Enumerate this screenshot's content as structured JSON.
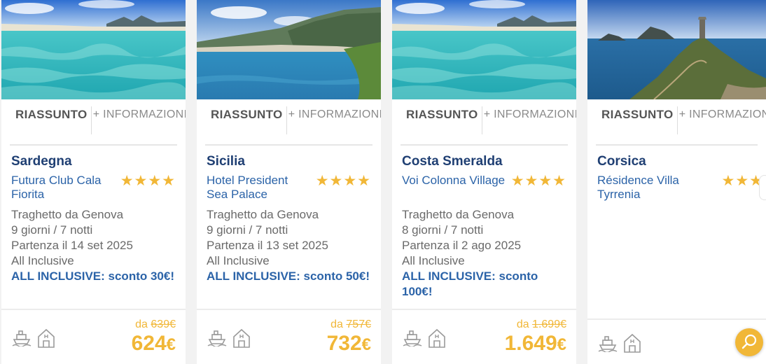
{
  "tabs": {
    "summary": "RIASSUNTO",
    "info": "+ INFORMAZIONI"
  },
  "cards": [
    {
      "region": "Sardegna",
      "hotel": "Futura Club Cala Fiorita",
      "stars": "★★★★",
      "details": [
        "Traghetto da Genova",
        "9 giorni / 7 notti",
        "Partenza il 14 set 2025",
        "All Inclusive"
      ],
      "promo": "ALL INCLUSIVE: sconto 30€!",
      "price_prefix": "da",
      "price_old": "639€",
      "price_new": "624",
      "currency": "€"
    },
    {
      "region": "Sicilia",
      "hotel": "Hotel President Sea Palace",
      "stars": "★★★★",
      "details": [
        "Traghetto da Genova",
        "9 giorni / 7 notti",
        "Partenza il 13 set 2025",
        "All Inclusive"
      ],
      "promo": "ALL INCLUSIVE: sconto 50€!",
      "price_prefix": "da",
      "price_old": "757€",
      "price_new": "732",
      "currency": "€"
    },
    {
      "region": "Costa Smeralda",
      "hotel": "Voi Colonna Village",
      "stars": "★★★★",
      "details": [
        "Traghetto da Genova",
        "8 giorni / 7 notti",
        "Partenza il 2 ago 2025",
        "All Inclusive"
      ],
      "promo": "ALL INCLUSIVE: sconto 100€!",
      "price_prefix": "da",
      "price_old": "1.699€",
      "price_new": "1.649",
      "currency": "€"
    },
    {
      "region": "Corsica",
      "hotel": "Résidence Villa Tyrrenia",
      "stars": "★★★"
    }
  ],
  "icons": {
    "ferry": "ferry-icon",
    "accommodation": "house-icon",
    "search": "search-icon"
  },
  "colors": {
    "navy": "#1f3f73",
    "link_blue": "#2b63a8",
    "accent": "#f1b737"
  }
}
